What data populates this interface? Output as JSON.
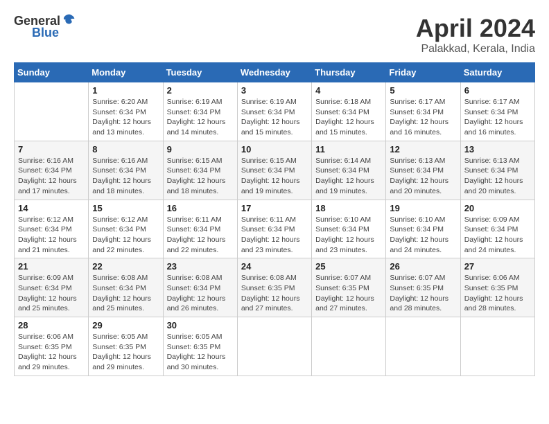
{
  "header": {
    "logo_general": "General",
    "logo_blue": "Blue",
    "month_year": "April 2024",
    "location": "Palakkad, Kerala, India"
  },
  "columns": [
    "Sunday",
    "Monday",
    "Tuesday",
    "Wednesday",
    "Thursday",
    "Friday",
    "Saturday"
  ],
  "weeks": [
    [
      {
        "day": "",
        "info": ""
      },
      {
        "day": "1",
        "info": "Sunrise: 6:20 AM\nSunset: 6:34 PM\nDaylight: 12 hours\nand 13 minutes."
      },
      {
        "day": "2",
        "info": "Sunrise: 6:19 AM\nSunset: 6:34 PM\nDaylight: 12 hours\nand 14 minutes."
      },
      {
        "day": "3",
        "info": "Sunrise: 6:19 AM\nSunset: 6:34 PM\nDaylight: 12 hours\nand 15 minutes."
      },
      {
        "day": "4",
        "info": "Sunrise: 6:18 AM\nSunset: 6:34 PM\nDaylight: 12 hours\nand 15 minutes."
      },
      {
        "day": "5",
        "info": "Sunrise: 6:17 AM\nSunset: 6:34 PM\nDaylight: 12 hours\nand 16 minutes."
      },
      {
        "day": "6",
        "info": "Sunrise: 6:17 AM\nSunset: 6:34 PM\nDaylight: 12 hours\nand 16 minutes."
      }
    ],
    [
      {
        "day": "7",
        "info": "Sunrise: 6:16 AM\nSunset: 6:34 PM\nDaylight: 12 hours\nand 17 minutes."
      },
      {
        "day": "8",
        "info": "Sunrise: 6:16 AM\nSunset: 6:34 PM\nDaylight: 12 hours\nand 18 minutes."
      },
      {
        "day": "9",
        "info": "Sunrise: 6:15 AM\nSunset: 6:34 PM\nDaylight: 12 hours\nand 18 minutes."
      },
      {
        "day": "10",
        "info": "Sunrise: 6:15 AM\nSunset: 6:34 PM\nDaylight: 12 hours\nand 19 minutes."
      },
      {
        "day": "11",
        "info": "Sunrise: 6:14 AM\nSunset: 6:34 PM\nDaylight: 12 hours\nand 19 minutes."
      },
      {
        "day": "12",
        "info": "Sunrise: 6:13 AM\nSunset: 6:34 PM\nDaylight: 12 hours\nand 20 minutes."
      },
      {
        "day": "13",
        "info": "Sunrise: 6:13 AM\nSunset: 6:34 PM\nDaylight: 12 hours\nand 20 minutes."
      }
    ],
    [
      {
        "day": "14",
        "info": "Sunrise: 6:12 AM\nSunset: 6:34 PM\nDaylight: 12 hours\nand 21 minutes."
      },
      {
        "day": "15",
        "info": "Sunrise: 6:12 AM\nSunset: 6:34 PM\nDaylight: 12 hours\nand 22 minutes."
      },
      {
        "day": "16",
        "info": "Sunrise: 6:11 AM\nSunset: 6:34 PM\nDaylight: 12 hours\nand 22 minutes."
      },
      {
        "day": "17",
        "info": "Sunrise: 6:11 AM\nSunset: 6:34 PM\nDaylight: 12 hours\nand 23 minutes."
      },
      {
        "day": "18",
        "info": "Sunrise: 6:10 AM\nSunset: 6:34 PM\nDaylight: 12 hours\nand 23 minutes."
      },
      {
        "day": "19",
        "info": "Sunrise: 6:10 AM\nSunset: 6:34 PM\nDaylight: 12 hours\nand 24 minutes."
      },
      {
        "day": "20",
        "info": "Sunrise: 6:09 AM\nSunset: 6:34 PM\nDaylight: 12 hours\nand 24 minutes."
      }
    ],
    [
      {
        "day": "21",
        "info": "Sunrise: 6:09 AM\nSunset: 6:34 PM\nDaylight: 12 hours\nand 25 minutes."
      },
      {
        "day": "22",
        "info": "Sunrise: 6:08 AM\nSunset: 6:34 PM\nDaylight: 12 hours\nand 25 minutes."
      },
      {
        "day": "23",
        "info": "Sunrise: 6:08 AM\nSunset: 6:34 PM\nDaylight: 12 hours\nand 26 minutes."
      },
      {
        "day": "24",
        "info": "Sunrise: 6:08 AM\nSunset: 6:35 PM\nDaylight: 12 hours\nand 27 minutes."
      },
      {
        "day": "25",
        "info": "Sunrise: 6:07 AM\nSunset: 6:35 PM\nDaylight: 12 hours\nand 27 minutes."
      },
      {
        "day": "26",
        "info": "Sunrise: 6:07 AM\nSunset: 6:35 PM\nDaylight: 12 hours\nand 28 minutes."
      },
      {
        "day": "27",
        "info": "Sunrise: 6:06 AM\nSunset: 6:35 PM\nDaylight: 12 hours\nand 28 minutes."
      }
    ],
    [
      {
        "day": "28",
        "info": "Sunrise: 6:06 AM\nSunset: 6:35 PM\nDaylight: 12 hours\nand 29 minutes."
      },
      {
        "day": "29",
        "info": "Sunrise: 6:05 AM\nSunset: 6:35 PM\nDaylight: 12 hours\nand 29 minutes."
      },
      {
        "day": "30",
        "info": "Sunrise: 6:05 AM\nSunset: 6:35 PM\nDaylight: 12 hours\nand 30 minutes."
      },
      {
        "day": "",
        "info": ""
      },
      {
        "day": "",
        "info": ""
      },
      {
        "day": "",
        "info": ""
      },
      {
        "day": "",
        "info": ""
      }
    ]
  ]
}
